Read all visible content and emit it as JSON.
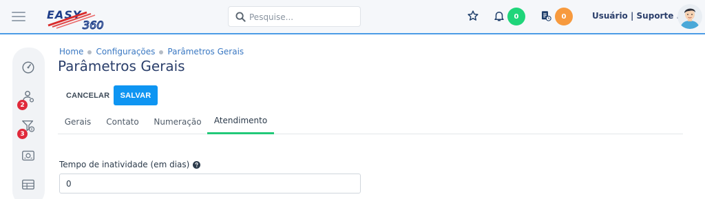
{
  "colors": {
    "topbar_bg": "#f5f7fa",
    "topbar_border": "#4b9be6",
    "primary": "#0e95f2",
    "tab_active_underline": "#22c979",
    "notification_badge": "#1fd57a",
    "tasks_badge": "#f79a3e",
    "sidebar_badge": "#e02a3b",
    "title": "#2b3f6b",
    "link": "#3a78c2"
  },
  "header": {
    "logo_text": "EASY 360",
    "search": {
      "placeholder": "Pesquise...",
      "value": ""
    },
    "favorites_icon": "star-icon",
    "notifications": {
      "icon": "bell-icon",
      "count": "0"
    },
    "tasks": {
      "icon": "tasks-icon",
      "count": "0"
    },
    "user_label": "Usuário | Suporte ..."
  },
  "sidebar": {
    "items": [
      {
        "name": "dashboard",
        "icon": "speedometer-icon",
        "badge": ""
      },
      {
        "name": "users",
        "icon": "user-settings-icon",
        "badge": "2"
      },
      {
        "name": "finance-filter",
        "icon": "funnel-money-icon",
        "badge": "3"
      },
      {
        "name": "cashier",
        "icon": "cash-register-icon",
        "badge": ""
      },
      {
        "name": "tables",
        "icon": "table-icon",
        "badge": ""
      }
    ]
  },
  "breadcrumb": [
    "Home",
    "Configurações",
    "Parâmetros Gerais"
  ],
  "page": {
    "title": "Parâmetros Gerais",
    "cancel_label": "CANCELAR",
    "save_label": "SALVAR"
  },
  "tabs": [
    {
      "label": "Gerais",
      "active": false
    },
    {
      "label": "Contato",
      "active": false
    },
    {
      "label": "Numeração",
      "active": false
    },
    {
      "label": "Atendimento",
      "active": true
    }
  ],
  "form": {
    "inactivity_label": "Tempo de inatividade (em dias)",
    "inactivity_value": "0",
    "help_icon": "question-circle-icon"
  }
}
